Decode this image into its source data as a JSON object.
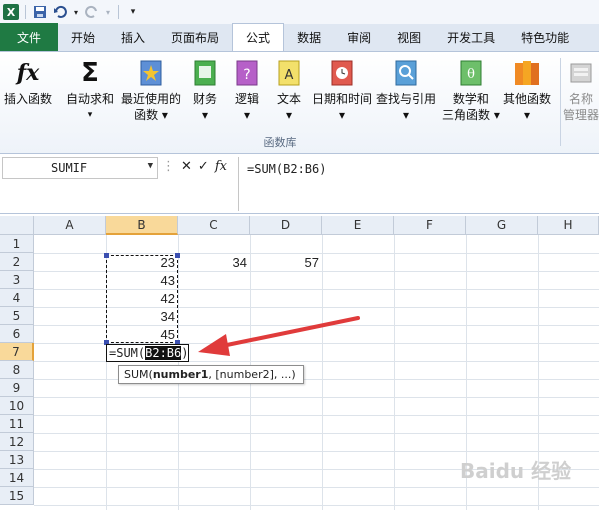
{
  "qat": {
    "logo": "X"
  },
  "tabs": [
    "文件",
    "开始",
    "插入",
    "页面布局",
    "公式",
    "数据",
    "审阅",
    "视图",
    "开发工具",
    "特色功能"
  ],
  "ribbon": {
    "buttons": [
      {
        "label": "插入函数",
        "sub": ""
      },
      {
        "label": "自动求和",
        "sub": "▾"
      },
      {
        "label": "最近使用的",
        "sub": "函数 ▾"
      },
      {
        "label": "财务",
        "sub": "▾"
      },
      {
        "label": "逻辑",
        "sub": "▾"
      },
      {
        "label": "文本",
        "sub": "▾"
      },
      {
        "label": "日期和时间",
        "sub": "▾"
      },
      {
        "label": "查找与引用",
        "sub": "▾"
      },
      {
        "label": "数学和",
        "sub": "三角函数 ▾"
      },
      {
        "label": "其他函数",
        "sub": "▾"
      },
      {
        "label": "名称",
        "sub": "管理器"
      }
    ],
    "group_label": "函数库"
  },
  "formula_bar": {
    "name_box": "SUMIF",
    "formula": "=SUM(B2:B6)"
  },
  "columns": [
    "A",
    "B",
    "C",
    "D",
    "E",
    "F",
    "G",
    "H"
  ],
  "rows": [
    "1",
    "2",
    "3",
    "4",
    "5",
    "6",
    "7",
    "8",
    "9",
    "10",
    "11",
    "12",
    "13",
    "14",
    "15"
  ],
  "cells": {
    "B2": "23",
    "C2": "34",
    "D2": "57",
    "B3": "43",
    "B4": "42",
    "B5": "34",
    "B6": "45"
  },
  "edit_cell": {
    "prefix": "=SUM(",
    "ref": "B2:B6",
    "suffix": ")"
  },
  "tooltip": {
    "fn": "SUM(",
    "arg1": "number1",
    "rest": ", [number2], ...)"
  },
  "watermark": "Baidu 经验",
  "colors": {
    "excel_green": "#1f7a43",
    "accent_red": "#e03b3b",
    "selection": "#f9d99a"
  }
}
